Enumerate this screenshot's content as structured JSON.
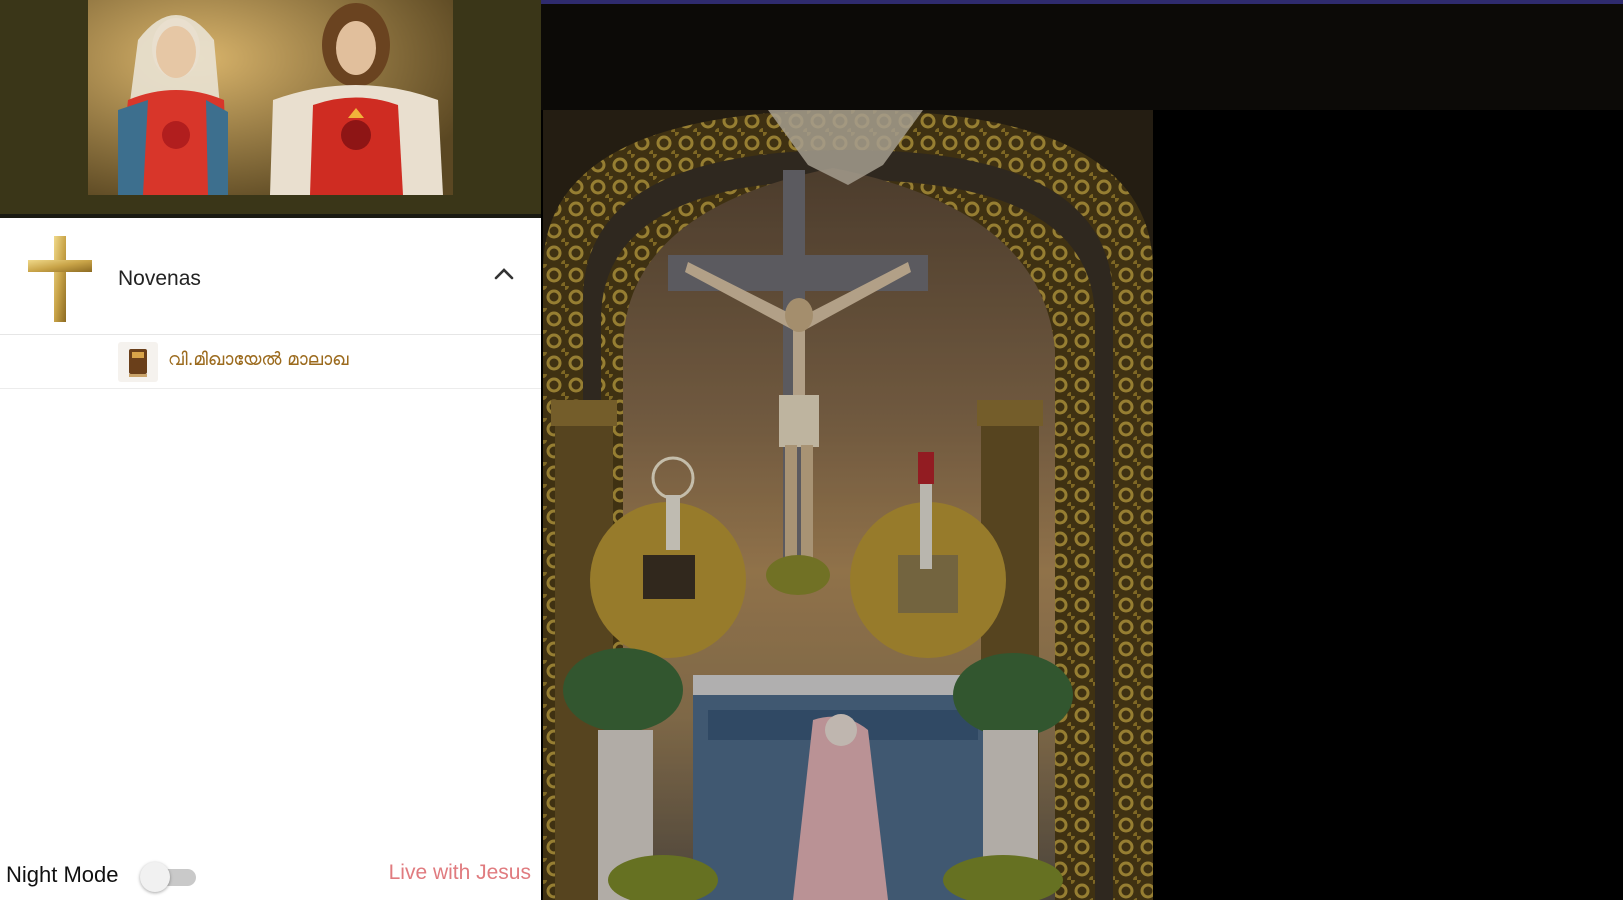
{
  "drawer": {
    "menu_group": {
      "label": "Novenas",
      "icon": "cross-icon",
      "expanded": true
    },
    "submenu": [
      {
        "label": "വി.മിഖായേൽ മാലാഖ",
        "icon": "book-icon"
      }
    ],
    "footer": {
      "night_mode_label": "Night Mode",
      "night_mode_on": false,
      "live_link": "Live with Jesus"
    }
  },
  "colors": {
    "header_bg": "#3a3618",
    "accent_label": "#9b6a1d",
    "link": "#e07b7f",
    "top_line": "#2f2b6e"
  }
}
